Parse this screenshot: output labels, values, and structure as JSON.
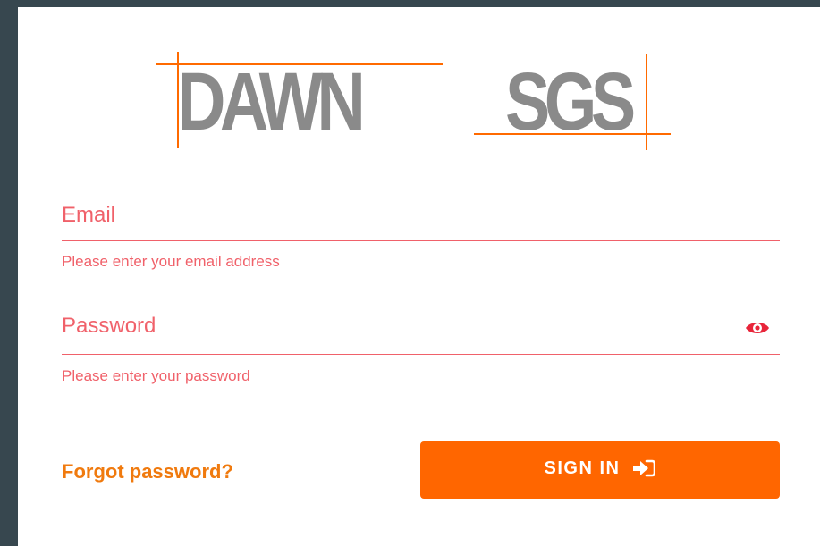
{
  "logo": {
    "word_left": "DAWN",
    "word_right": "SGS",
    "text_color": "#8a8a8a",
    "crop_mark_color": "#ff6a00"
  },
  "email": {
    "placeholder": "Email",
    "value": "",
    "helper": "Please enter your email address"
  },
  "password": {
    "placeholder": "Password",
    "value": "",
    "helper": "Please enter your password",
    "toggle_icon": "eye-icon"
  },
  "actions": {
    "forgot_label": "Forgot password?",
    "signin_label": "SIGN IN",
    "signin_icon": "sign-in-icon"
  },
  "colors": {
    "error": "#f0616a",
    "accent": "#ff6600",
    "link": "#f07a0e",
    "frame": "#37474f"
  }
}
